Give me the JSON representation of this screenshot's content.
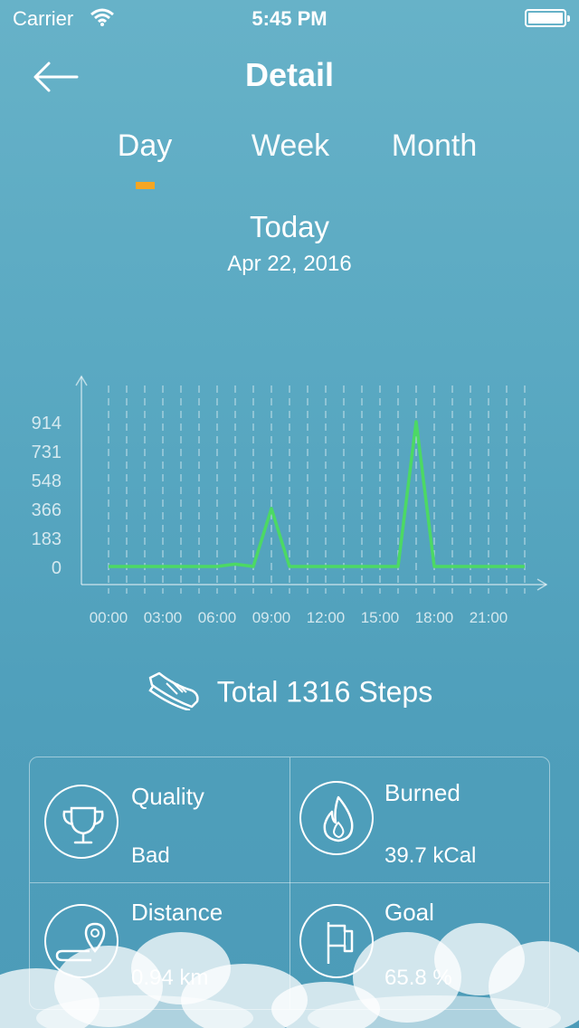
{
  "status_bar": {
    "carrier": "Carrier",
    "time": "5:45 PM"
  },
  "header": {
    "title": "Detail"
  },
  "tabs": [
    {
      "label": "Day",
      "selected": true
    },
    {
      "label": "Week",
      "selected": false
    },
    {
      "label": "Month",
      "selected": false
    }
  ],
  "period": {
    "label": "Today",
    "date": "Apr 22, 2016"
  },
  "colors": {
    "accent": "#f5a623",
    "line": "#4cd964"
  },
  "chart_data": {
    "type": "line",
    "x": [
      "00:00",
      "01:00",
      "02:00",
      "03:00",
      "04:00",
      "05:00",
      "06:00",
      "07:00",
      "08:00",
      "09:00",
      "10:00",
      "11:00",
      "12:00",
      "13:00",
      "14:00",
      "15:00",
      "16:00",
      "17:00",
      "18:00",
      "19:00",
      "20:00",
      "21:00",
      "22:00",
      "23:00"
    ],
    "values": [
      0,
      0,
      0,
      0,
      0,
      0,
      0,
      15,
      0,
      366,
      0,
      0,
      0,
      0,
      0,
      0,
      0,
      914,
      0,
      0,
      0,
      0,
      0,
      0
    ],
    "y_ticks": [
      "0",
      "183",
      "366",
      "548",
      "731",
      "914"
    ],
    "x_tick_labels": [
      "00:00",
      "03:00",
      "06:00",
      "09:00",
      "12:00",
      "15:00",
      "18:00",
      "21:00"
    ],
    "ylim": [
      0,
      914
    ],
    "grid": "vertical dashed"
  },
  "summary": {
    "total_text": "Total 1316 Steps"
  },
  "stats": {
    "quality": {
      "label": "Quality",
      "value": "Bad",
      "icon": "trophy-icon"
    },
    "burned": {
      "label": "Burned",
      "value": "39.7 kCal",
      "icon": "flame-icon"
    },
    "distance": {
      "label": "Distance",
      "value": "0.94 km",
      "icon": "location-pin-icon"
    },
    "goal": {
      "label": "Goal",
      "value": "65.8 %",
      "icon": "flag-icon"
    }
  }
}
